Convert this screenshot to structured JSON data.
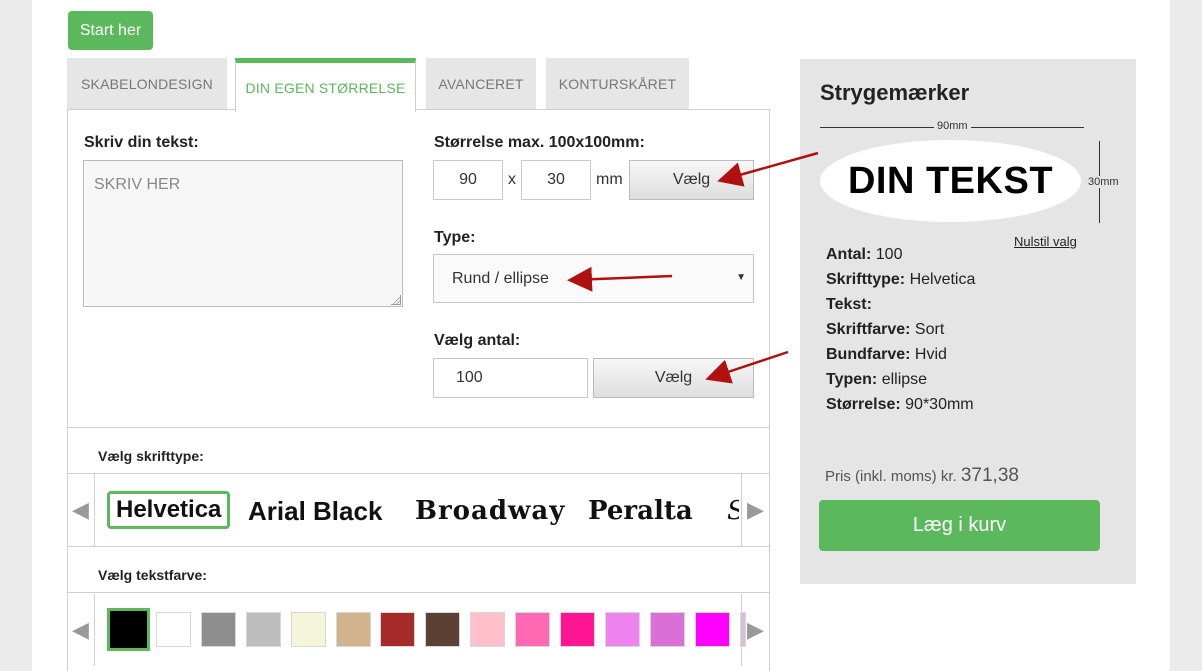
{
  "start_button": "Start her",
  "tabs": [
    {
      "label": "SKABELONDESIGN"
    },
    {
      "label": "DIN EGEN STØRRELSE"
    },
    {
      "label": "AVANCERET"
    },
    {
      "label": "KONTURSKÅRET"
    }
  ],
  "text_section": {
    "label": "Skriv din tekst:",
    "placeholder": "SKRIV HER"
  },
  "size_section": {
    "label": "Størrelse max. 100x100mm:",
    "width": "90",
    "times": "x",
    "height": "30",
    "unit": "mm",
    "button": "Vælg"
  },
  "type_section": {
    "label": "Type:",
    "selected": "Rund / ellipse"
  },
  "quantity_section": {
    "label": "Vælg antal:",
    "value": "100",
    "button": "Vælg"
  },
  "font_section": {
    "label": "Vælg skrifttype:",
    "fonts": [
      "Helvetica",
      "Arial Black",
      "Broadway",
      "Peralta",
      "S"
    ]
  },
  "color_section": {
    "label": "Vælg tekstfarve:",
    "swatches": [
      "#000000",
      "#ffffff",
      "#8e8e8e",
      "#bdbdbd",
      "#f5f5dc",
      "#d2b48c",
      "#a52a2a",
      "#5c4033",
      "#ffc0cb",
      "#ff69b4",
      "#ff1493",
      "#ee82ee",
      "#da70d6",
      "#ff00ff",
      "#d8bfd8"
    ]
  },
  "sidebar": {
    "title": "Strygemærker",
    "width_label": "90mm",
    "height_label": "30mm",
    "preview_text": "DIN TEKST",
    "reset": "Nulstil valg",
    "summary": [
      {
        "key": "Antal:",
        "value": " 100"
      },
      {
        "key": "Skrifttype:",
        "value": " Helvetica"
      },
      {
        "key": "Tekst:",
        "value": ""
      },
      {
        "key": "Skriftfarve:",
        "value": " Sort"
      },
      {
        "key": "Bundfarve:",
        "value": " Hvid"
      },
      {
        "key": "Typen:",
        "value": " ellipse"
      },
      {
        "key": "Størrelse:",
        "value": " 90*30mm"
      }
    ],
    "price_label": "Pris (inkl. moms) kr.",
    "price_value": "371,38",
    "cart_button": "Læg i kurv"
  },
  "colors": {
    "accent": "#5cb85c",
    "annotation_arrow": "#b01010"
  }
}
